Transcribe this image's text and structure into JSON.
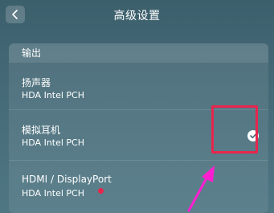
{
  "header": {
    "title": "高级设置",
    "back_icon": "chevron-left-icon"
  },
  "output": {
    "section_label": "输出",
    "devices": [
      {
        "name": "扬声器",
        "detail": "HDA Intel PCH",
        "selected": false
      },
      {
        "name": "模拟耳机",
        "detail": "HDA Intel PCH",
        "selected": true
      },
      {
        "name": "HDMI / DisplayPort",
        "detail": "HDA Intel PCH",
        "selected": false
      }
    ]
  },
  "annotations": {
    "highlight_color": "#e8254c",
    "arrow_color": "#ff1fd0"
  },
  "colors": {
    "background_top": "#3c5f6c",
    "background_bottom": "#4f7683"
  }
}
